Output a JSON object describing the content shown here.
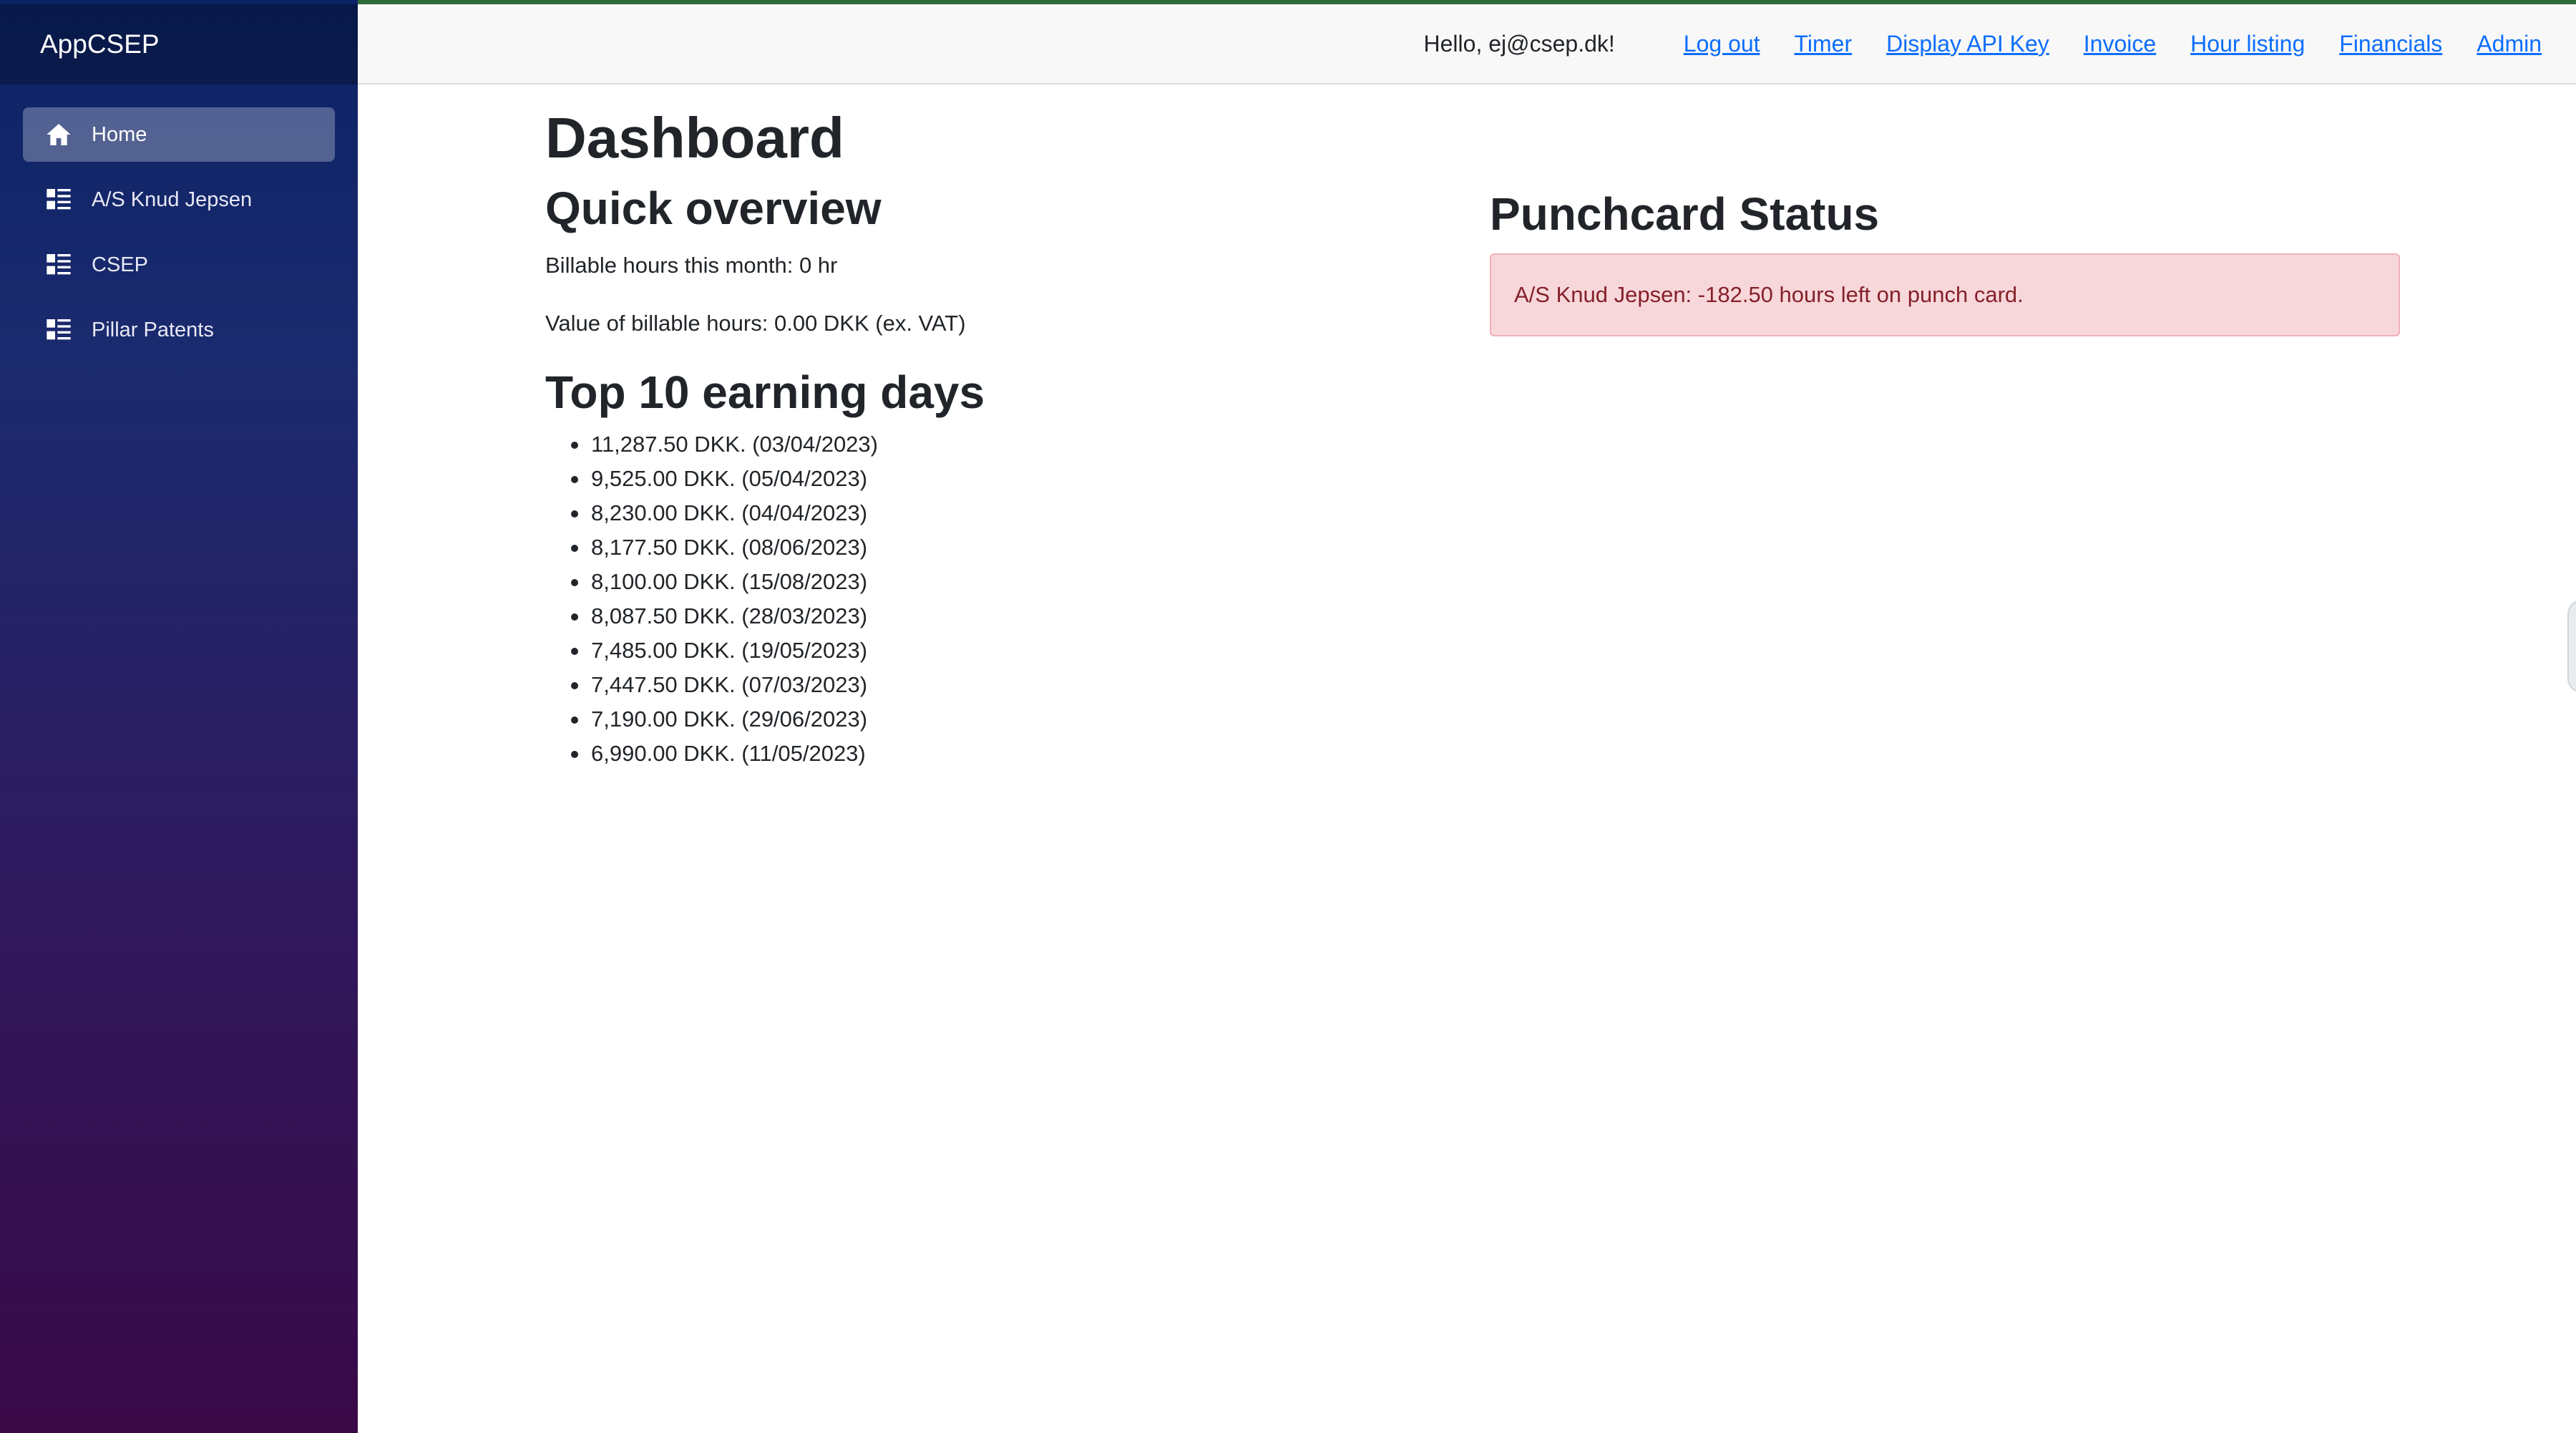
{
  "app": {
    "brand": "AppCSEP"
  },
  "sidebar": {
    "items": [
      {
        "label": "Home",
        "icon": "home-icon",
        "active": true
      },
      {
        "label": "A/S Knud Jepsen",
        "icon": "list-icon",
        "active": false
      },
      {
        "label": "CSEP",
        "icon": "list-icon",
        "active": false
      },
      {
        "label": "Pillar Patents",
        "icon": "list-icon",
        "active": false
      }
    ]
  },
  "topnav": {
    "greeting": "Hello, ej@csep.dk!",
    "links": [
      "Log out",
      "Timer",
      "Display API Key",
      "Invoice",
      "Hour listing",
      "Financials",
      "Admin"
    ]
  },
  "dashboard": {
    "title": "Dashboard",
    "quick_overview": {
      "heading": "Quick overview",
      "billable_hours": "Billable hours this month: 0 hr",
      "billable_value": "Value of billable hours: 0.00 DKK (ex. VAT)"
    },
    "top_days": {
      "heading": "Top 10 earning days",
      "items": [
        "11,287.50 DKK. (03/04/2023)",
        "9,525.00 DKK. (05/04/2023)",
        "8,230.00 DKK. (04/04/2023)",
        "8,177.50 DKK. (08/06/2023)",
        "8,100.00 DKK. (15/08/2023)",
        "8,087.50 DKK. (28/03/2023)",
        "7,485.00 DKK. (19/05/2023)",
        "7,447.50 DKK. (07/03/2023)",
        "7,190.00 DKK. (29/06/2023)",
        "6,990.00 DKK. (11/05/2023)"
      ]
    },
    "punchcard": {
      "heading": "Punchcard Status",
      "alert": "A/S Knud Jepsen: -182.50 hours left on punch card."
    }
  },
  "colors": {
    "link": "#0d6efd",
    "alert_bg": "#f8d7da",
    "alert_text": "#842029",
    "sidebar_top": "#0b2366",
    "sidebar_bottom": "#3a0a47"
  }
}
